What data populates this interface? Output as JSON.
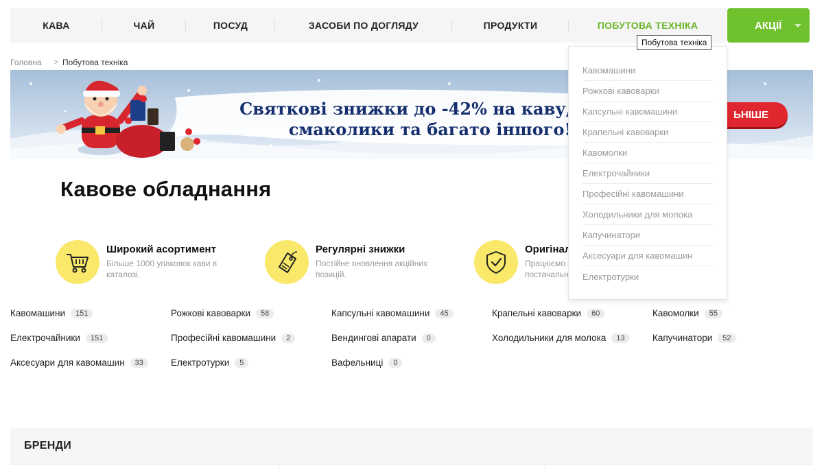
{
  "nav": {
    "items": [
      "КАВА",
      "ЧАЙ",
      "ПОСУД",
      "ЗАСОБИ ПО ДОГЛЯДУ",
      "ПРОДУКТИ",
      "ПОБУТОВА ТЕХНІКА"
    ],
    "active_index": 5,
    "promo_label": "АКЦІЇ"
  },
  "tooltip": "Побутова техніка",
  "breadcrumb": {
    "home": "Головна",
    "current": "Побутова техніка"
  },
  "banner": {
    "line1": "Святкові знижки до -42% на каву,",
    "line2": "смаколики та багато іншого!",
    "button_label": "ЬНІШЕ"
  },
  "dropdown": {
    "items": [
      "Кавомашини",
      "Рожкові кавоварки",
      "Капсульні кавомашини",
      "Крапельні кавоварки",
      "Кавомолки",
      "Електрочайники",
      "Професійні кавомашини",
      "Холодильники для молока",
      "Капучинатори",
      "Аксесуари для кавомашин",
      "Електротурки"
    ]
  },
  "page_title": "Кавове обладнання",
  "features": [
    {
      "title": "Широкий асортимент",
      "desc": "Більше 1000 упаковок кави в каталозі.",
      "icon": "cart-icon"
    },
    {
      "title": "Регулярні знижки",
      "desc": "Постійне оновлення акційних позицій.",
      "icon": "price-tag-icon"
    },
    {
      "title": "Оригінал",
      "desc": "Працюємо постачальн",
      "icon": "shield-check-icon"
    }
  ],
  "categories": [
    {
      "name": "Кавомашини",
      "count": "151"
    },
    {
      "name": "Рожкові кавоварки",
      "count": "58"
    },
    {
      "name": "Капсульні кавомашини",
      "count": "45"
    },
    {
      "name": "Крапельні кавоварки",
      "count": "60"
    },
    {
      "name": "Кавомолки",
      "count": "55"
    },
    {
      "name": "Електрочайники",
      "count": "151"
    },
    {
      "name": "Професійні кавомашини",
      "count": "2"
    },
    {
      "name": "Вендингові апарати",
      "count": "0"
    },
    {
      "name": "Холодильники для молока",
      "count": "13"
    },
    {
      "name": "Капучинатори",
      "count": "52"
    },
    {
      "name": "Аксесуари для кавомашин",
      "count": "33"
    },
    {
      "name": "Електротурки",
      "count": "5"
    },
    {
      "name": "Вафельниці",
      "count": "0"
    }
  ],
  "brands": {
    "title": "БРЕНДИ"
  },
  "colors": {
    "accent_green": "#6fc12e",
    "active_nav": "#6bb52a",
    "feature_circle": "#fae86a",
    "banner_text": "#142e6e",
    "banner_button": "#e0262f"
  }
}
